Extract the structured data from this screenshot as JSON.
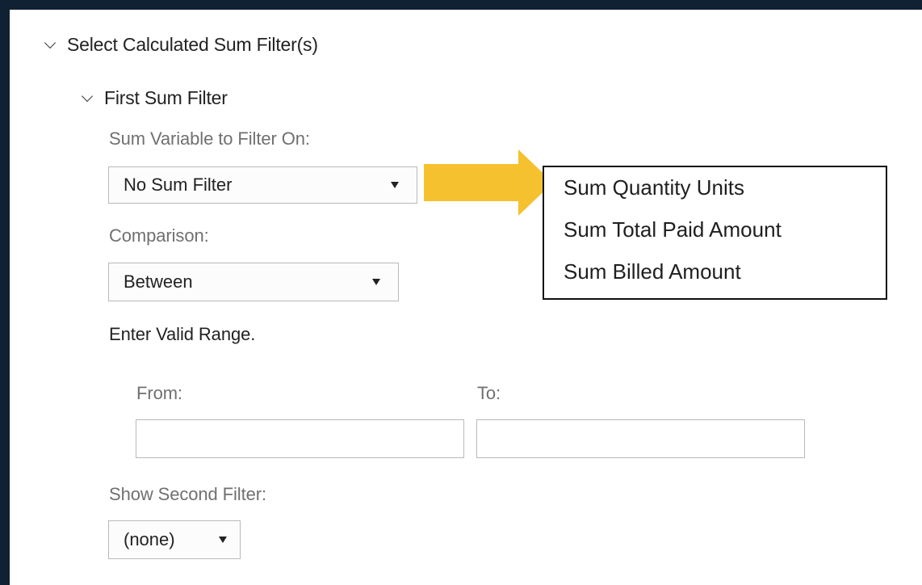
{
  "section": {
    "title": "Select Calculated Sum Filter(s)",
    "expand_icon": "chevron-down-icon"
  },
  "subsection": {
    "title": "First Sum Filter",
    "expand_icon": "chevron-down-icon"
  },
  "sum_variable": {
    "label": "Sum Variable to Filter On:",
    "selected": "No Sum Filter",
    "options": [
      "Sum Quantity Units",
      "Sum Total Paid Amount",
      "Sum Billed Amount"
    ]
  },
  "comparison": {
    "label": "Comparison:",
    "selected": "Between"
  },
  "range": {
    "instruction": "Enter Valid Range.",
    "from_label": "From:",
    "from_value": "",
    "to_label": "To:",
    "to_value": ""
  },
  "second_filter": {
    "label": "Show Second Filter:",
    "selected": "(none)"
  },
  "annotation": {
    "arrow_color": "#f5c12e",
    "arrow_icon": "arrow-right-icon"
  },
  "colors": {
    "frame": "#0f2132",
    "panel": "#ffffff",
    "muted_text": "#707070"
  }
}
